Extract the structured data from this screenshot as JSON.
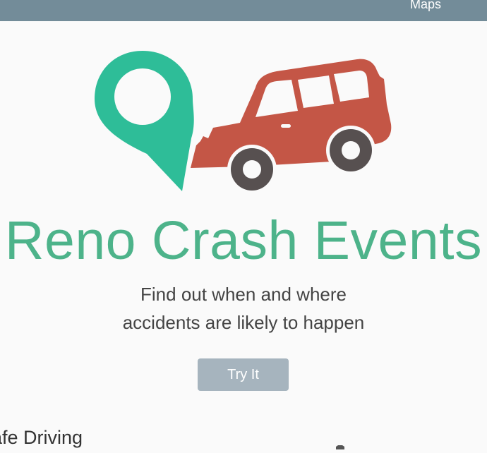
{
  "nav": {
    "maps_label": "Maps"
  },
  "hero": {
    "logo_icon": "map-pin-car-crash-logo",
    "title": "Reno Crash Events",
    "subtitle_line1": "Find out when and where",
    "subtitle_line2": "accidents are likely to happen",
    "cta_label": "Try It"
  },
  "section": {
    "heading": "afe Driving"
  },
  "colors": {
    "topbar": "#738c99",
    "accent_green": "#4db38a",
    "pin_green": "#2ebd98",
    "car_red": "#c45646",
    "wheel_dark": "#575050",
    "button": "#a6b4be"
  }
}
